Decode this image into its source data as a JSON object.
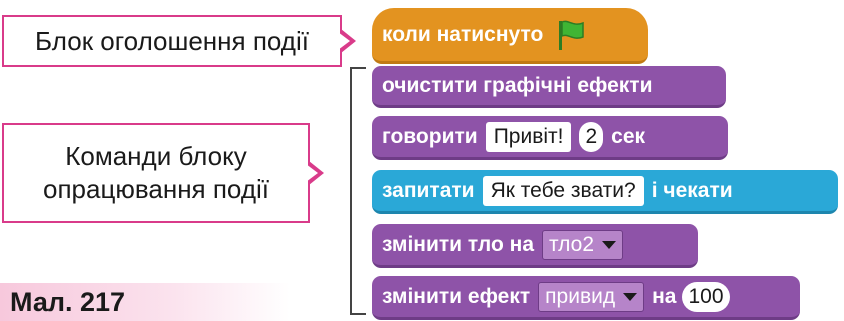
{
  "callouts": {
    "event_block": "Блок оголошення події",
    "commands_line1": "Команди блоку",
    "commands_line2": "опрацювання події"
  },
  "figure_label": "Мал. 217",
  "hat_block": {
    "label": "коли натиснуто",
    "icon": "green-flag-icon"
  },
  "blocks": {
    "clear_effects": {
      "label": "очистити графічні ефекти"
    },
    "say": {
      "label": "говорити",
      "message": "Привіт!",
      "seconds": "2",
      "unit": "сек"
    },
    "ask": {
      "label": "запитати",
      "question": "Як тебе звати?",
      "suffix": "і чекати"
    },
    "switch_backdrop": {
      "label": "змінити тло на",
      "backdrop": "тло2"
    },
    "change_effect": {
      "label": "змінити ефект",
      "effect": "привид",
      "by_label": "на",
      "value": "100"
    }
  },
  "colors": {
    "events": "#e39320",
    "looks": "#8e53a8",
    "sensing": "#2aa8d7",
    "callout_border": "#d93b8a",
    "flag": "#3fb534"
  }
}
